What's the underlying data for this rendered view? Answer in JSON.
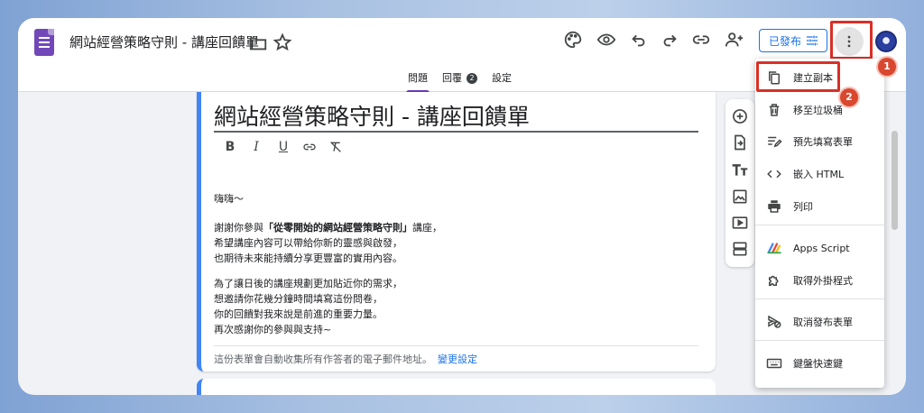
{
  "header": {
    "doc_title": "網站經營策略守則 - 講座回饋單",
    "publish_label": "已發布"
  },
  "tabs": [
    {
      "label": "問題"
    },
    {
      "label": "回覆",
      "badge": "2"
    },
    {
      "label": "設定"
    }
  ],
  "form": {
    "title": "網站經營策略守則 - 講座回饋單",
    "greeting": "嗨嗨～",
    "p1_prefix": "謝謝你參與",
    "p1_bold": "「從零開始的網站經營策略守則」",
    "p1_suffix": "講座，",
    "p1_line2": "希望講座內容可以帶給你新的靈感與啟發，",
    "p1_line3": "也期待未來能持續分享更豐富的實用內容。",
    "p2_line1": "為了讓日後的講座規劃更加貼近你的需求，",
    "p2_line2": "想邀請你花幾分鐘時間填寫這份問卷，",
    "p2_line3": "你的回饋對我來說是前進的重要力量。",
    "p2_line4": "再次感謝你的參與與支持~",
    "email_note": "這份表單會自動收集所有作答者的電子郵件地址。",
    "change_link": "變更設定"
  },
  "menu": {
    "items": [
      {
        "label": "建立副本",
        "icon": "copy-icon"
      },
      {
        "label": "移至垃圾桶",
        "icon": "trash-icon"
      },
      {
        "label": "預先填寫表單",
        "icon": "prefill-icon"
      },
      {
        "label": "嵌入 HTML",
        "icon": "code-icon"
      },
      {
        "label": "列印",
        "icon": "print-icon"
      },
      {
        "label": "Apps Script",
        "icon": "apps-script-icon"
      },
      {
        "label": "取得外掛程式",
        "icon": "addon-icon"
      },
      {
        "label": "取消發布表單",
        "icon": "unpublish-icon"
      },
      {
        "label": "鍵盤快速鍵",
        "icon": "keyboard-icon"
      }
    ]
  },
  "annotations": {
    "step1": "1",
    "step2": "2",
    "highlight_color": "#d93025"
  },
  "colors": {
    "accent": "#673ab7",
    "link": "#1a73e8",
    "card_border": "#4285f4"
  }
}
